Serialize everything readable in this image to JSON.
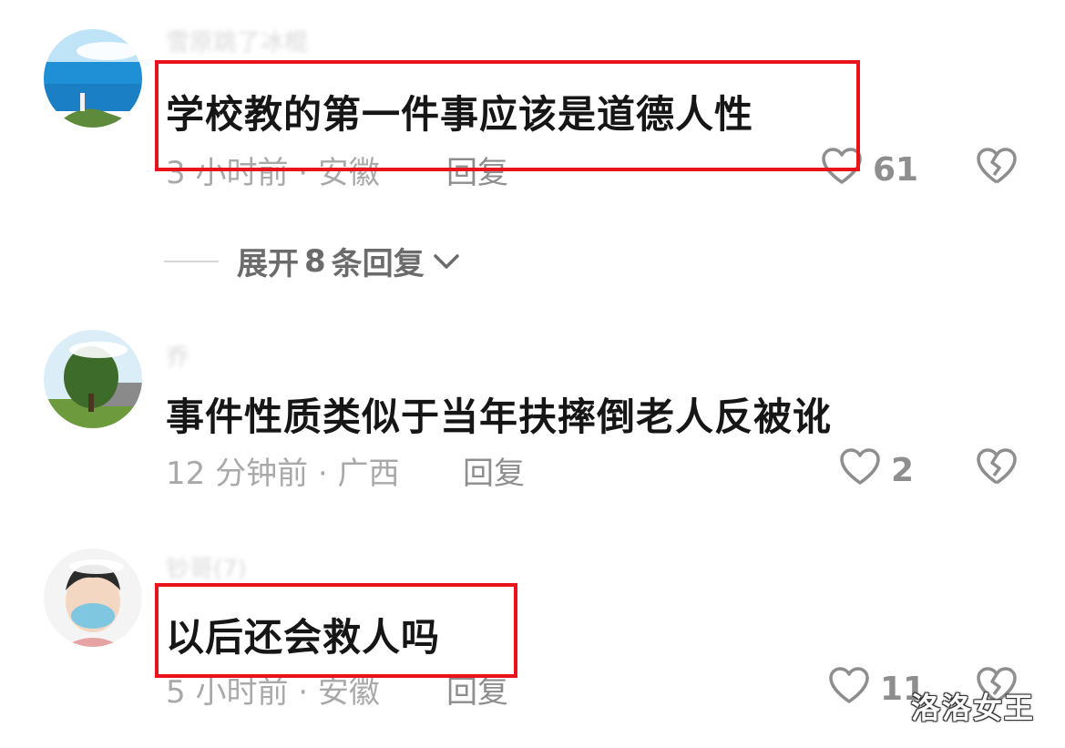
{
  "comments": [
    {
      "username": "雪原跳了冰棍",
      "text": "学校教的第一件事应该是道德人性",
      "time_location": "3 小时前 · 安徽",
      "reply_label": "回复",
      "likes": "61",
      "highlighted": true
    },
    {
      "username": "乔",
      "text": "事件性质类似于当年扶摔倒老人反被讹",
      "time_location": "12 分钟前 · 广西",
      "reply_label": "回复",
      "likes": "2",
      "highlighted": false
    },
    {
      "username": "钞哥(7)",
      "text": "以后还会救人吗",
      "time_location": "5 小时前 · 安徽",
      "reply_label": "回复",
      "likes": "11",
      "highlighted": true
    }
  ],
  "expand_replies": {
    "prefix": "展开",
    "count": "8",
    "suffix": "条回复"
  },
  "watermark": "洛洛女王",
  "icons": {
    "like": "heart-outline-icon",
    "dislike": "broken-heart-icon",
    "expand": "chevron-down-icon"
  },
  "colors": {
    "highlight_border": "#e8141c",
    "meta_text": "#a9a9a9",
    "icon": "#8e8e8e"
  }
}
